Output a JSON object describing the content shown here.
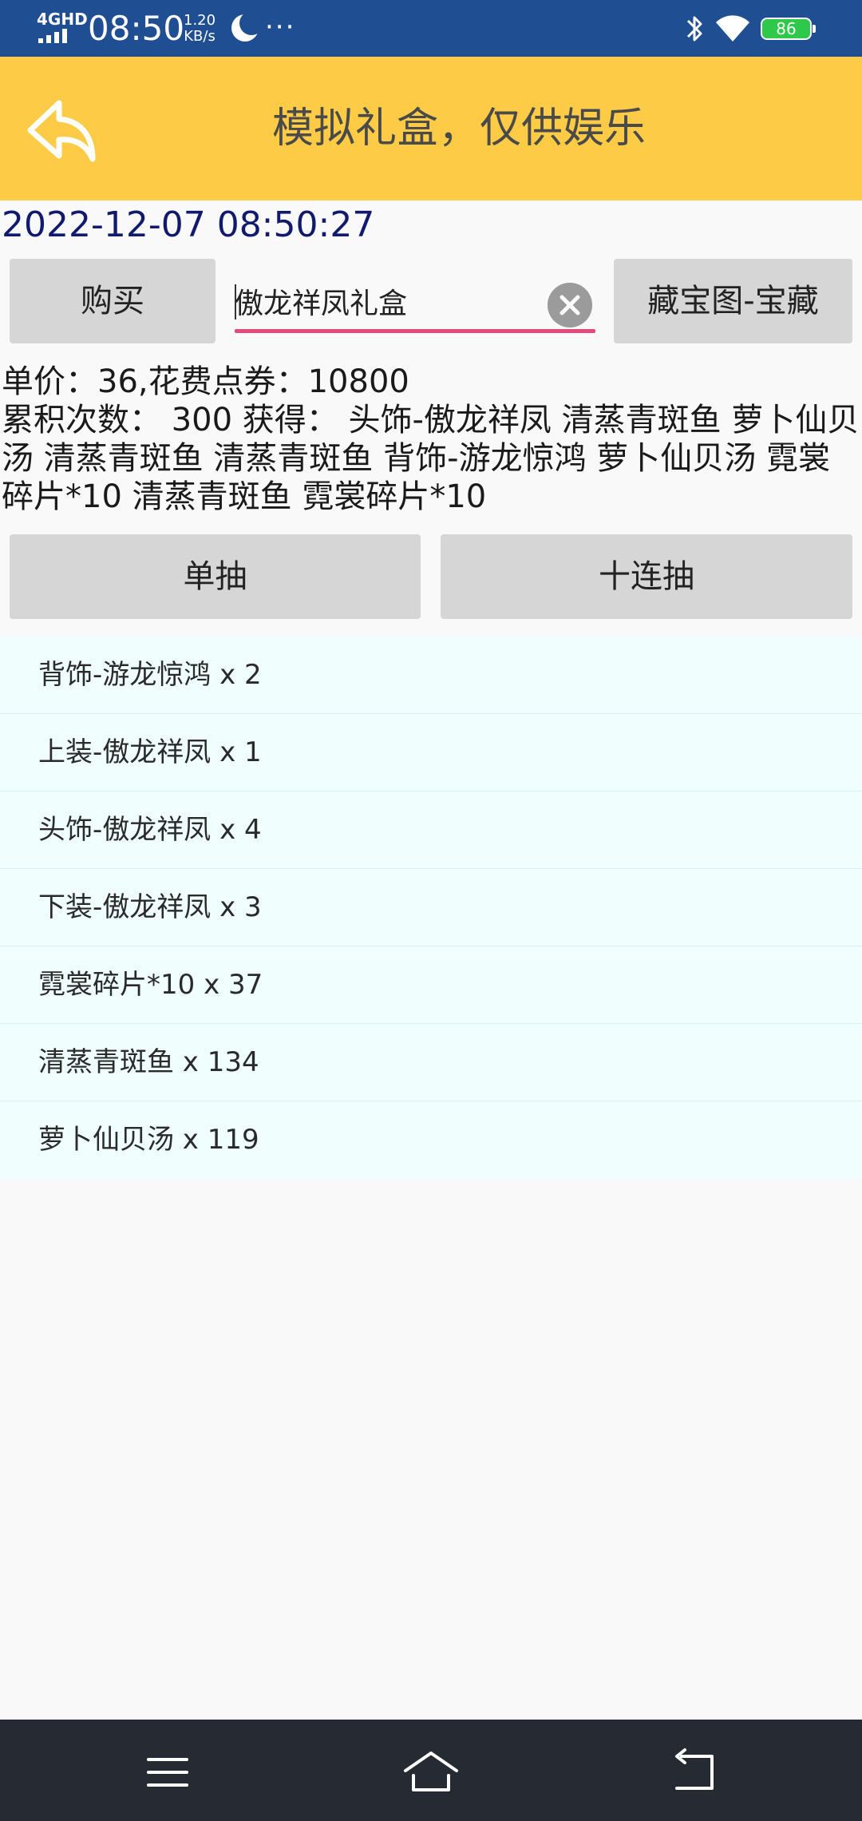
{
  "status_bar": {
    "network": "4GHD",
    "time": "08:50",
    "speed_value": "1.20",
    "speed_unit": "KB/s",
    "more": "···",
    "battery": "86",
    "icons": [
      "signal-icon",
      "moon-icon",
      "bluetooth-icon",
      "wifi-icon",
      "battery-icon"
    ]
  },
  "toolbar": {
    "title": "模拟礼盒，仅供娱乐",
    "back_icon": "back-arrow-icon",
    "color": "#fecb47"
  },
  "datetime": "2022-12-07 08:50:27",
  "actions": {
    "buy_label": "购买",
    "search_value": "傲龙祥凤礼盒",
    "map_label": "藏宝图-宝藏",
    "single_draw_label": "单抽",
    "ten_draw_label": "十连抽"
  },
  "info": {
    "line1": "单价：36,花费点券：10800",
    "line2": "累积次数： 300 获得：  头饰-傲龙祥凤 清蒸青斑鱼 萝卜仙贝汤 清蒸青斑鱼 清蒸青斑鱼 背饰-游龙惊鸿 萝卜仙贝汤 霓裳碎片*10 清蒸青斑鱼 霓裳碎片*10"
  },
  "results": [
    "背饰-游龙惊鸿 x 2",
    "上装-傲龙祥凤 x 1",
    "头饰-傲龙祥凤 x 4",
    "下装-傲龙祥凤 x 3",
    "霓裳碎片*10 x 37",
    "清蒸青斑鱼 x 134",
    "萝卜仙贝汤 x 119"
  ],
  "nav_bar": {
    "icons": [
      "menu-icon",
      "home-icon",
      "back-icon"
    ]
  }
}
